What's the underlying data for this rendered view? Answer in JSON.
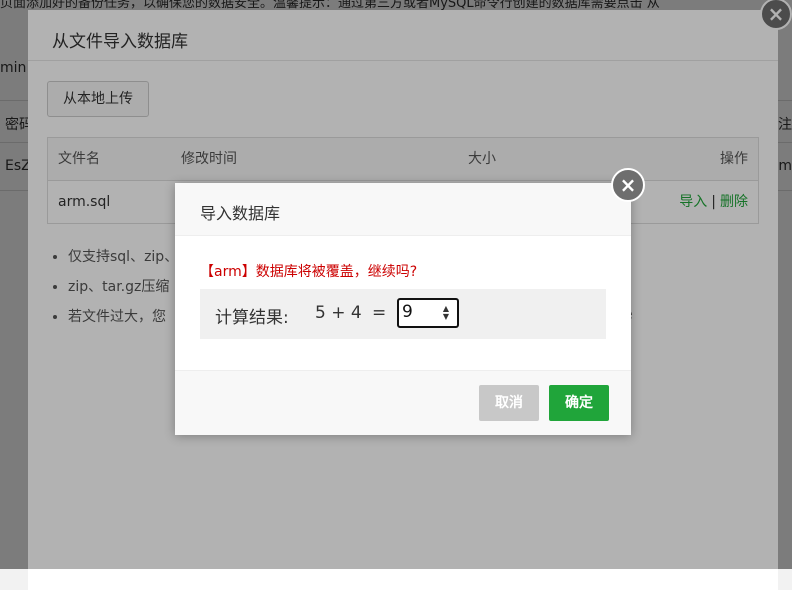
{
  "background": {
    "top_notice": "页面添加好的备份任务，以确保您的数据安全。温馨提示：通过第三方或者MySQL命令行创建的数据库需要点击 从",
    "col_fragment_admin": "min",
    "col_fragment_password": "密码",
    "row_fragment": "EsZ",
    "right_fragment_1": "注",
    "right_fragment_2": "m"
  },
  "outer_dialog": {
    "title": "从文件导入数据库",
    "upload_button": "从本地上传",
    "table": {
      "headers": {
        "name": "文件名",
        "time": "修改时间",
        "size": "大小",
        "ops": "操作"
      },
      "rows": [
        {
          "name": "arm.sql",
          "import": "导入",
          "sep": "|",
          "delete": "删除"
        }
      ]
    },
    "notes": [
      "仅支持sql、zip、",
      "zip、tar.gz压缩",
      "若文件过大，您"
    ],
    "notes_tail": "e"
  },
  "import_dialog": {
    "title": "导入数据库",
    "warning": "【arm】数据库将被覆盖，继续吗?",
    "calc_label": "计算结果:",
    "calc_expression": "5 + 4",
    "calc_equals": "=",
    "calc_value": "9",
    "cancel_label": "取消",
    "confirm_label": "确定"
  },
  "icons": {
    "close": "close-icon",
    "spin_up": "▲",
    "spin_down": "▼",
    "close_glyph": "×"
  },
  "colors": {
    "accent": "#20a53a",
    "warning": "#cc0000"
  }
}
